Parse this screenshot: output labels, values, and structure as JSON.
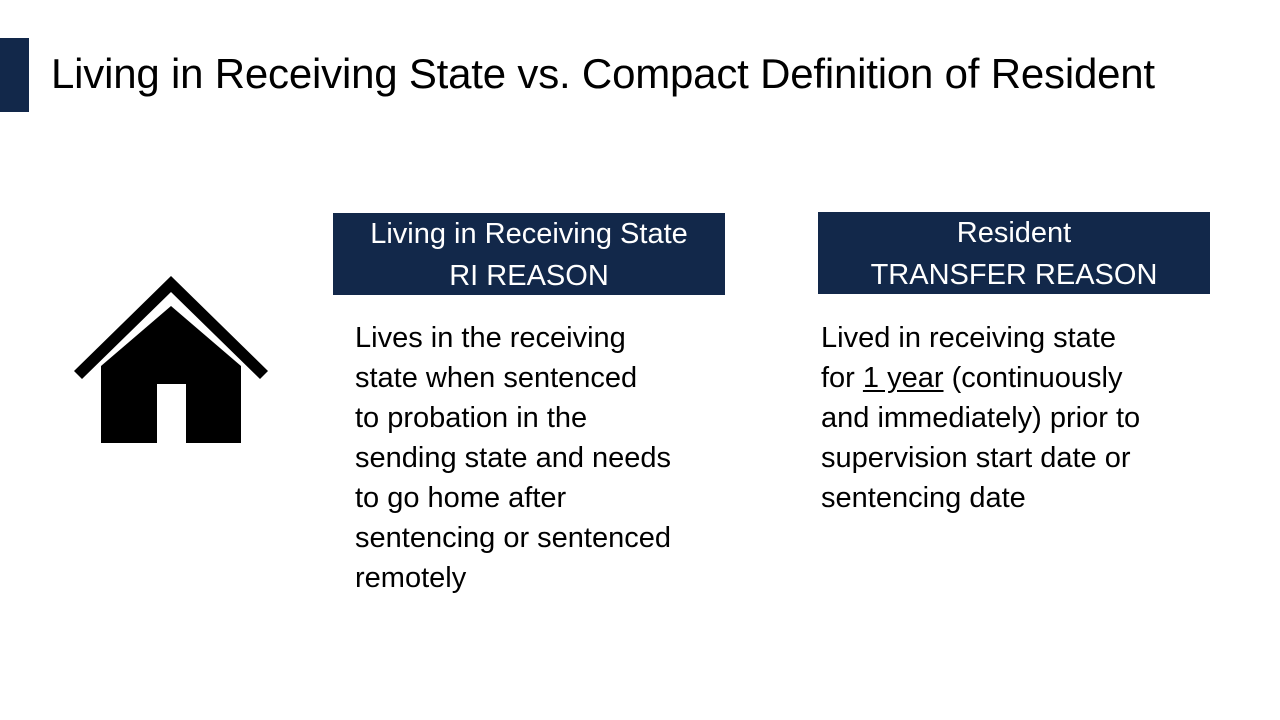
{
  "slide": {
    "title": "Living in Receiving State vs. Compact Definition of Resident",
    "accent_color": "#12284a",
    "icon": "house-icon"
  },
  "left_column": {
    "header_lines": [
      "Living in Receiving State",
      "RI REASON"
    ],
    "body_lines": [
      "Lives in the receiving",
      "state when sentenced",
      "to probation in the",
      "sending state and needs",
      "to go home after",
      "sentencing or sentenced",
      "remotely"
    ]
  },
  "right_column": {
    "header_lines": [
      "Resident",
      "TRANSFER REASON"
    ],
    "body": {
      "line1": "Lived in receiving state",
      "line2_prefix": "for ",
      "line2_underlined": "1 year",
      "line2_suffix": " (continuously",
      "line3": "and immediately) prior to",
      "line4": "supervision start date or",
      "line5": "sentencing date"
    }
  }
}
